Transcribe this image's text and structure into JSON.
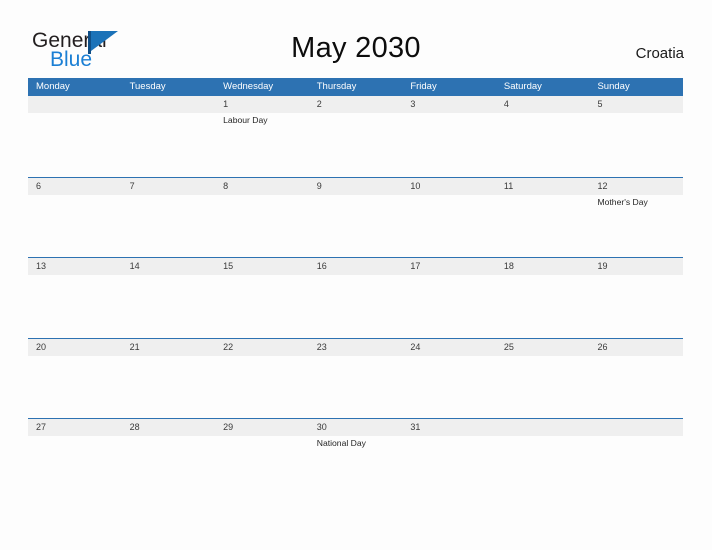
{
  "brand": {
    "name_part1": "General",
    "name_part2": "Blue",
    "flag_icon": "flag-icon",
    "colors": {
      "dark_text": "#231f20",
      "blue_text": "#1b7fd4",
      "flag_blue": "#1b72b8",
      "flag_pole": "#0f4e86"
    }
  },
  "header": {
    "title": "May 2030",
    "country": "Croatia"
  },
  "calendar": {
    "colors": {
      "header_blue": "#2d72b2",
      "row_band_gray": "#efefef",
      "row_divider": "#2d72b2"
    },
    "weekdays": [
      "Monday",
      "Tuesday",
      "Wednesday",
      "Thursday",
      "Friday",
      "Saturday",
      "Sunday"
    ],
    "weeks": [
      {
        "days": [
          {
            "number": "",
            "event": ""
          },
          {
            "number": "",
            "event": ""
          },
          {
            "number": "1",
            "event": "Labour Day"
          },
          {
            "number": "2",
            "event": ""
          },
          {
            "number": "3",
            "event": ""
          },
          {
            "number": "4",
            "event": ""
          },
          {
            "number": "5",
            "event": ""
          }
        ]
      },
      {
        "days": [
          {
            "number": "6",
            "event": ""
          },
          {
            "number": "7",
            "event": ""
          },
          {
            "number": "8",
            "event": ""
          },
          {
            "number": "9",
            "event": ""
          },
          {
            "number": "10",
            "event": ""
          },
          {
            "number": "11",
            "event": ""
          },
          {
            "number": "12",
            "event": "Mother's Day"
          }
        ]
      },
      {
        "days": [
          {
            "number": "13",
            "event": ""
          },
          {
            "number": "14",
            "event": ""
          },
          {
            "number": "15",
            "event": ""
          },
          {
            "number": "16",
            "event": ""
          },
          {
            "number": "17",
            "event": ""
          },
          {
            "number": "18",
            "event": ""
          },
          {
            "number": "19",
            "event": ""
          }
        ]
      },
      {
        "days": [
          {
            "number": "20",
            "event": ""
          },
          {
            "number": "21",
            "event": ""
          },
          {
            "number": "22",
            "event": ""
          },
          {
            "number": "23",
            "event": ""
          },
          {
            "number": "24",
            "event": ""
          },
          {
            "number": "25",
            "event": ""
          },
          {
            "number": "26",
            "event": ""
          }
        ]
      },
      {
        "days": [
          {
            "number": "27",
            "event": ""
          },
          {
            "number": "28",
            "event": ""
          },
          {
            "number": "29",
            "event": ""
          },
          {
            "number": "30",
            "event": "National Day"
          },
          {
            "number": "31",
            "event": ""
          },
          {
            "number": "",
            "event": ""
          },
          {
            "number": "",
            "event": ""
          }
        ]
      }
    ]
  }
}
